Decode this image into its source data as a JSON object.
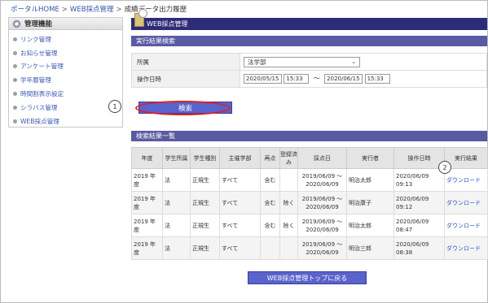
{
  "breadcrumb": {
    "home": "ポータルHOME",
    "sep1": ">",
    "web": "WEB採点管理",
    "sep2": ">",
    "current": "成績データ出力履歴"
  },
  "sidebar": {
    "title": "管理機能",
    "items": [
      {
        "label": "リンク管理"
      },
      {
        "label": "お知らせ管理"
      },
      {
        "label": "アンケート管理"
      },
      {
        "label": "学年暦管理"
      },
      {
        "label": "時間割表示設定"
      },
      {
        "label": "シラバス管理"
      },
      {
        "label": "WEB採点管理"
      }
    ]
  },
  "main": {
    "title": "WEB採点管理"
  },
  "search_form": {
    "heading": "実行結果検索",
    "dept_label": "所属",
    "dept_value": "法学部",
    "date_label": "操作日時",
    "from_date": "2020/05/15",
    "from_time": "15:33",
    "tilde": "～",
    "to_date": "2020/06/15",
    "to_time": "15:33",
    "search_label": "検索"
  },
  "callouts": {
    "one": "1",
    "two": "2"
  },
  "results": {
    "heading": "検索結果一覧",
    "columns": [
      "年度",
      "学生所属",
      "学生種別",
      "主催学部",
      "再点",
      "登録済み",
      "採点日",
      "実行者",
      "操作日時",
      "実行結果"
    ],
    "rows": [
      {
        "year": "2019 年度",
        "dept": "法",
        "type": "正規生",
        "host": "すべて",
        "re": "含む",
        "reg": "",
        "period": "2019/06/09 ～2020/06/09",
        "user": "明治太郎",
        "op": "2020/06/09 09:13",
        "result": "ダウンロード"
      },
      {
        "year": "2019 年度",
        "dept": "法",
        "type": "正規生",
        "host": "すべて",
        "re": "含む",
        "reg": "除く",
        "period": "2019/06/09 ～2020/06/09",
        "user": "明治康子",
        "op": "2020/06/09 09:12",
        "result": "ダウンロード"
      },
      {
        "year": "2019 年度",
        "dept": "法",
        "type": "正規生",
        "host": "すべて",
        "re": "含む",
        "reg": "除く",
        "period": "2019/06/09 ～2020/06/09",
        "user": "明治太郎",
        "op": "2020/06/09 08:47",
        "result": "ダウンロード"
      },
      {
        "year": "2019 年度",
        "dept": "法",
        "type": "正規生",
        "host": "すべて",
        "re": "",
        "reg": "",
        "period": "2019/06/09 ～2020/06/09",
        "user": "明治三郎",
        "op": "2020/06/09 08:38",
        "result": "ダウンロード"
      }
    ]
  },
  "footer": {
    "back_label": "WEB採点管理トップに戻る"
  },
  "colors": {
    "title_bar": "#2c2c78",
    "section_head": "#5a5aa2",
    "button": "#5a62cc",
    "highlight": "#e02020",
    "link": "#3355bb"
  }
}
